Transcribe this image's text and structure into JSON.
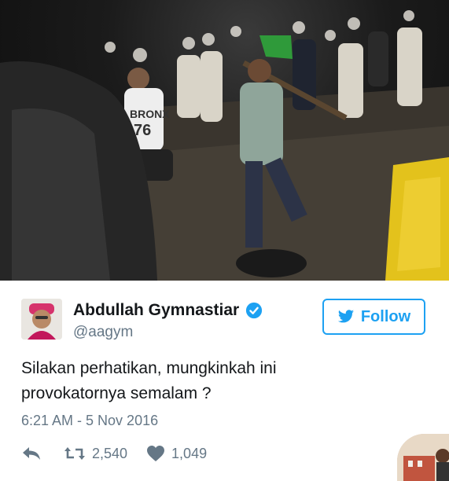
{
  "photo": {
    "jersey_text": "BRONX",
    "jersey_number": "76"
  },
  "tweet": {
    "author_name": "Abdullah Gymnastiar",
    "handle": "@aagym",
    "follow_label": "Follow",
    "text_line1": "Silakan perhatikan, mungkinkah ini",
    "text_line2": "provokatornya semalam ?",
    "timestamp": "6:21 AM - 5 Nov 2016",
    "retweet_count": "2,540",
    "like_count": "1,049"
  },
  "icons": {
    "verified": "verified-badge-icon",
    "twitter_bird": "twitter-bird-icon",
    "reply": "reply-icon",
    "retweet": "retweet-icon",
    "like": "heart-icon"
  },
  "colors": {
    "accent": "#1da1f2",
    "text": "#14171a",
    "muted": "#657786"
  }
}
